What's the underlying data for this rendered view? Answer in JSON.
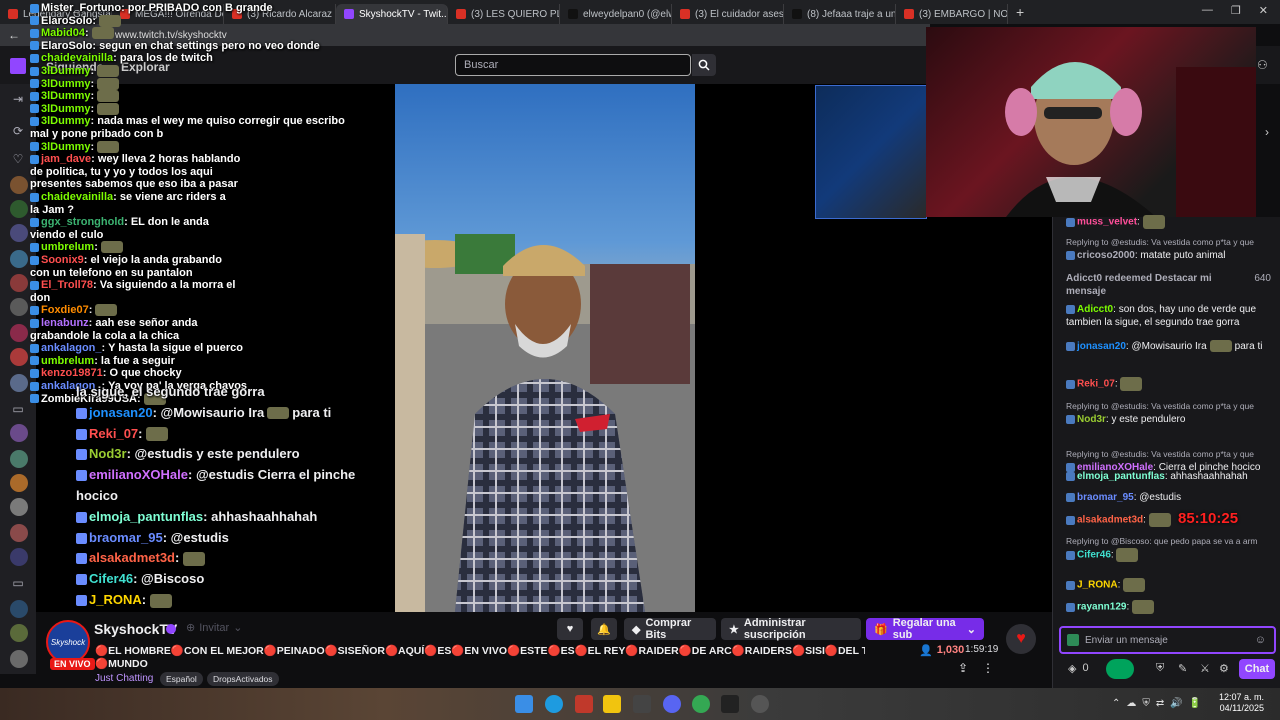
{
  "browser": {
    "tabs": [
      {
        "label": "Legendary Gangsta Ra...",
        "color": "#d93025"
      },
      {
        "label": "MEGA!!! Ofrenda Del 2...",
        "color": "#d93025"
      },
      {
        "label": "(3) Ricardo Alcaraz - Yo...",
        "color": "#d93025"
      },
      {
        "label": "SkyshockTV - Twit...",
        "color": "#9146ff",
        "active": true
      },
      {
        "label": "(3) LES QUIERO PLATIC...",
        "color": "#d93025"
      },
      {
        "label": "elweydelpan0 (@elwey...",
        "color": "#111111"
      },
      {
        "label": "(3) El cuidador asesino...",
        "color": "#d93025"
      },
      {
        "label": "(8) Jefaaa traje a unos...",
        "color": "#111111"
      },
      {
        "label": "(3) EMBARGO | NOS AT...",
        "color": "#d93025"
      }
    ],
    "url": "www.twitch.tv/skyshocktv"
  },
  "twitch_header": {
    "following": "Siguiendo",
    "browse": "Explorar",
    "search_placeholder": "Buscar"
  },
  "overlay_chat_small": [
    {
      "user": "Mister_Fortuno",
      "text": "por PRIBADO con B grande",
      "color": "#ffffff"
    },
    {
      "user": "ElaroSolo",
      "text": "",
      "color": "#ffffff"
    },
    {
      "user": "Mabid04",
      "text": "",
      "color": "#7cfc00"
    },
    {
      "user": "ElaroSolo",
      "text": "segun en chat settings pero no veo donde",
      "color": "#ffffff"
    },
    {
      "user": "chaidevainilla",
      "text": "para los de twitch",
      "color": "#7cfc00"
    },
    {
      "user": "3lDummy",
      "text": "",
      "color": "#7cfc00"
    },
    {
      "user": "3lDummy",
      "text": "",
      "color": "#7cfc00"
    },
    {
      "user": "3lDummy",
      "text": "",
      "color": "#7cfc00"
    },
    {
      "user": "3lDummy",
      "text": "",
      "color": "#7cfc00"
    },
    {
      "user": "3lDummy",
      "text": "nada mas el wey me quiso corregir que escribo",
      "color": "#7cfc00"
    },
    {
      "user": "",
      "text": "mal y pone pribado con b",
      "color": "#ffffff"
    },
    {
      "user": "3lDummy",
      "text": "",
      "color": "#7cfc00"
    },
    {
      "user": "jam_dave",
      "text": "wey lleva 2 horas hablando",
      "color": "#ff4f4f"
    },
    {
      "user": "",
      "text": "de politica, tu y yo y todos los aqui",
      "color": "#ffffff"
    },
    {
      "user": "",
      "text": "presentes sabemos que eso iba a pasar",
      "color": "#ffffff"
    },
    {
      "user": "chaidevainilla",
      "text": "se viene arc riders a",
      "color": "#7cfc00"
    },
    {
      "user": "",
      "text": "la Jam ?",
      "color": "#ffffff"
    },
    {
      "user": "ggx_stronghold",
      "text": "EL don le anda",
      "color": "#3cb371"
    },
    {
      "user": "",
      "text": "viendo el culo",
      "color": "#ffffff"
    },
    {
      "user": "umbrelum",
      "text": "",
      "color": "#7cfc00"
    },
    {
      "user": "Soonix9",
      "text": "el viejo la anda grabando",
      "color": "#ff4f4f"
    },
    {
      "user": "",
      "text": "con un telefono en su pantalon",
      "color": "#ffffff"
    },
    {
      "user": "El_Troll78",
      "text": "Va siguiendo a la morra el",
      "color": "#ff4f4f"
    },
    {
      "user": "",
      "text": "don",
      "color": "#ffffff"
    },
    {
      "user": "Foxdie07",
      "text": "",
      "color": "#ff8c00"
    },
    {
      "user": "lenabunz",
      "text": "aah ese señor anda",
      "color": "#b370ff"
    },
    {
      "user": "",
      "text": "grabandole la cola a la chica",
      "color": "#ffffff"
    },
    {
      "user": "ankalagon_",
      "text": "Y hasta la sigue el puerco",
      "color": "#6a8cff"
    },
    {
      "user": "umbrelum",
      "text": "la fue a seguir",
      "color": "#7cfc00"
    },
    {
      "user": "kenzo19871",
      "text": "O que chocky",
      "color": "#ff4f4f"
    },
    {
      "user": "ankalagon_",
      "text": "Ya voy pa' la verga chavos",
      "color": "#6a8cff"
    },
    {
      "user": "ZombieKira99USA",
      "text": "",
      "color": "#ffffff"
    }
  ],
  "overlay_chat_large": [
    {
      "user": "",
      "text": "la sigue, el segundo trae gorra",
      "color": "#ffffff"
    },
    {
      "user": "jonasan20",
      "text": "@Mowisaurio Ira",
      "tail": "para ti",
      "color": "#1e90ff"
    },
    {
      "user": "Reki_07",
      "text": "",
      "color": "#ff4f4f"
    },
    {
      "user": "Nod3r",
      "text": "@estudis y este pendulero",
      "color": "#9acd32"
    },
    {
      "user": "emilianoXOHale",
      "text": "@estudis Cierra el pinche",
      "color": "#d070ff"
    },
    {
      "user": "",
      "text": "hocico",
      "color": "#ffffff"
    },
    {
      "user": "elmoja_pantunflas",
      "text": "ahhashaahhahah",
      "color": "#7fffd4"
    },
    {
      "user": "braomar_95",
      "text": "@estudis",
      "color": "#6a8cff"
    },
    {
      "user": "alsakadmet3d",
      "text": "",
      "color": "#ff6347"
    },
    {
      "user": "Cifer46",
      "text": "@Biscoso",
      "color": "#40e0d0"
    },
    {
      "user": "J_RONA",
      "text": "",
      "color": "#ffd700"
    }
  ],
  "stream": {
    "channel": "SkyshockTV",
    "live_label": "EN VIVO",
    "title": "🔴EL HOMBRE🔴CON EL MEJOR🔴PEINADO🔴SISEÑOR🔴AQUÍ🔴ES🔴EN VIVO🔴ESTE🔴ES🔴EL REY🔴RAIDER🔴DE ARC🔴RAIDERS🔴SISI🔴DEL TARKOV🔴PARA",
    "title_line2": "🔴MUNDO",
    "category": "Just Chatting",
    "tags": [
      "Español",
      "DropsActivados"
    ],
    "viewers": "1,030",
    "uptime": "1:59:19",
    "invite": "Invitar",
    "buttons": {
      "buy_bits": "Comprar Bits",
      "manage_sub": "Administrar suscripción",
      "gift_sub": "Regalar una sub"
    }
  },
  "chat": {
    "messages": [
      {
        "user": "muss_velvet",
        "text": "",
        "color": "#ff4f9a"
      },
      {
        "reply": "Replying to @estudis: Va vestida como p*ta y que",
        "user": "cricoso2000",
        "text": "matate puto animal",
        "color": "#adadb8"
      },
      {
        "redeem": "Adicct0 redeemed Destacar mi mensaje",
        "points": "640"
      },
      {
        "user": "Adicct0",
        "text": "son dos, hay uno de verde que tambien la sigue, el segundo trae gorra",
        "color": "#7cfc00"
      },
      {
        "user": "jonasan20",
        "text": "@Mowisaurio Ira",
        "tail": "para ti",
        "color": "#1e90ff"
      },
      {
        "user": "Reki_07",
        "text": "",
        "color": "#ff4f4f"
      },
      {
        "reply": "Replying to @estudis: Va vestida como p*ta y que",
        "user": "Nod3r",
        "text": "y este pendulero",
        "color": "#9acd32"
      },
      {
        "reply": "Replying to @estudis: Va vestida como p*ta y que",
        "user": "emilianoXOHale",
        "text": "Cierra el pinche hocico",
        "color": "#d070ff"
      },
      {
        "user": "elmoja_pantunflas",
        "text": "ahhashaahhahah",
        "color": "#7fffd4"
      },
      {
        "user": "braomar_95",
        "text": "@estudis",
        "color": "#6a8cff"
      },
      {
        "user": "alsakadmet3d",
        "text": "",
        "color": "#ff6347"
      },
      {
        "reply": "Replying to @Biscoso: que pedo papa se va a arm",
        "user": "Cifer46",
        "text": "",
        "color": "#40e0d0"
      },
      {
        "user": "J_RONA",
        "text": "",
        "color": "#ffd700"
      },
      {
        "user": "rayann129",
        "text": "",
        "color": "#7fffd4"
      }
    ],
    "timer": "85:10:25",
    "input_placeholder": "Enviar un mensaje",
    "points": "0",
    "send_label": "Chat"
  },
  "taskbar": {
    "time": "12:07 a. m.",
    "date": "04/11/2025"
  }
}
